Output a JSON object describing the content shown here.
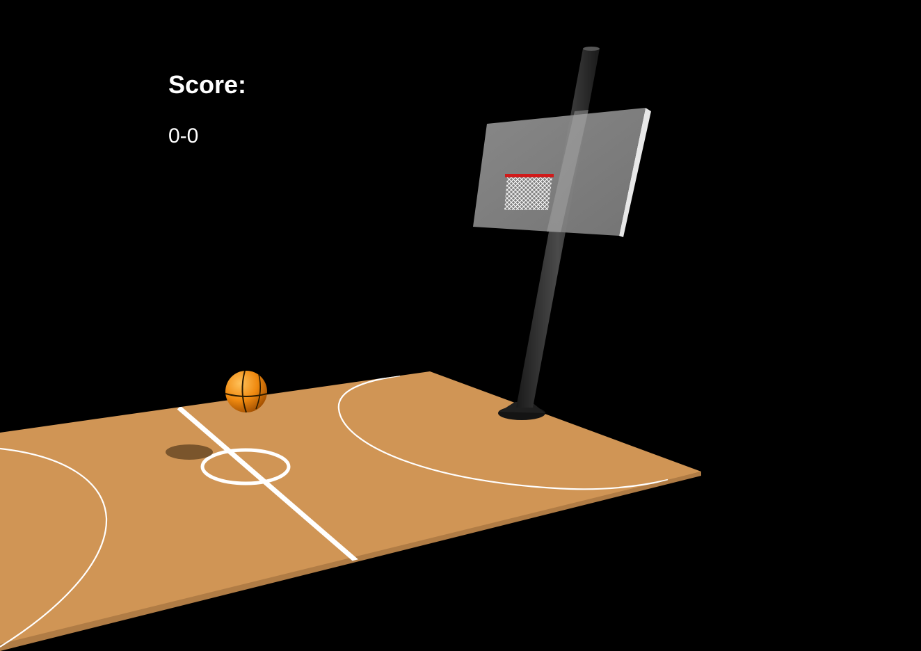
{
  "hud": {
    "score_label": "Score:",
    "score_value": "0-0"
  },
  "colors": {
    "background": "#000000",
    "court": "#d09555",
    "court_edge": "#b07c45",
    "court_lines": "#ffffff",
    "ball": "#f08a10",
    "rim": "#d11a1a",
    "pole": "#2b2b2b",
    "backboard": "#8a8a8a",
    "hud_text": "#ffffff"
  },
  "icons": {
    "ball": "basketball-icon"
  }
}
